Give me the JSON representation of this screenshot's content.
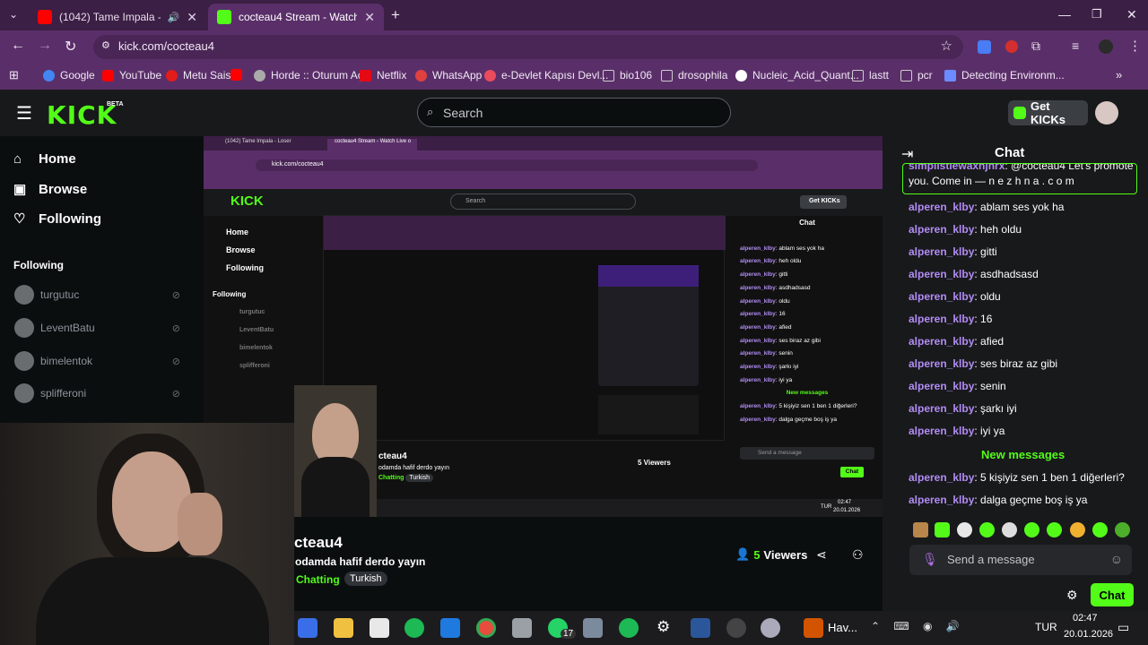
{
  "browser": {
    "tabs": [
      {
        "title": "(1042) Tame Impala - Loser",
        "favicon_color": "#ff0000"
      },
      {
        "title": "cocteau4 Stream - Watch Live o",
        "favicon_color": "#53fc18"
      }
    ],
    "new_tab_symbol": "+",
    "url": "kick.com/cocteau4",
    "bookmarks": [
      {
        "label": "Google",
        "color": "#4285f4"
      },
      {
        "label": "YouTube",
        "color": "#ff0000"
      },
      {
        "label": "Metu Sais",
        "color": "#e21b1b"
      },
      {
        "label": "",
        "color": "#ff0000"
      },
      {
        "label": "Horde :: Oturum Aç",
        "color": "#aaaaaa"
      },
      {
        "label": "Netflix",
        "color": "#e50914"
      },
      {
        "label": "WhatsApp",
        "color": "#e04040"
      },
      {
        "label": "e-Devlet Kapısı Devl...",
        "color": "#e94b5c"
      },
      {
        "label": "bio106",
        "color": "#cccccc"
      },
      {
        "label": "drosophila",
        "color": "#cccccc"
      },
      {
        "label": "Nucleic_Acid_Quant...",
        "color": "#ffffff"
      },
      {
        "label": "lastt",
        "color": "#cccccc"
      },
      {
        "label": "pcr",
        "color": "#cccccc"
      },
      {
        "label": "Detecting Environm...",
        "color": "#6a8cff"
      }
    ]
  },
  "kick": {
    "logo": "KICK",
    "beta": "BETA",
    "search_placeholder": "Search",
    "get_kicks": "Get KICKs",
    "accent": "#53fc18"
  },
  "sidebar": {
    "nav": [
      {
        "label": "Home",
        "icon": "home-icon"
      },
      {
        "label": "Browse",
        "icon": "browse-icon"
      },
      {
        "label": "Following",
        "icon": "heart-icon"
      }
    ],
    "following_title": "Following",
    "following": [
      "turgutuc",
      "LeventBatu",
      "bimelentok",
      "splifferoni"
    ]
  },
  "stream": {
    "channel": "cteau4",
    "title": "odamda hafif derdo yayın",
    "category": "Chatting",
    "tag": "Turkish",
    "viewers": "5",
    "viewers_label": "Viewers"
  },
  "inner": {
    "url": "kick.com/cocteau4",
    "search": "Search",
    "get_kicks": "Get KICKs",
    "nav": [
      "Home",
      "Browse",
      "Following"
    ],
    "following_title": "Following",
    "following": [
      "turgutuc",
      "LeventBatu",
      "bimelentok",
      "splifferoni"
    ],
    "chat_title": "Chat",
    "channel": "cteau4",
    "title": "odamda hafif derdo yayın",
    "category": "Chatting",
    "tag": "Turkish",
    "viewers": "5 Viewers",
    "send": "Send a message",
    "chat_btn": "Chat",
    "time": "02:47",
    "date": "20.01.2026",
    "lang": "TUR",
    "new_messages": "New messages",
    "messages": [
      {
        "user": "alperen_klby",
        "text": "ablam ses yok ha"
      },
      {
        "user": "alperen_klby",
        "text": "heh oldu"
      },
      {
        "user": "alperen_klby",
        "text": "gitti"
      },
      {
        "user": "alperen_klby",
        "text": "asdhadsasd"
      },
      {
        "user": "alperen_klby",
        "text": "oldu"
      },
      {
        "user": "alperen_klby",
        "text": "16"
      },
      {
        "user": "alperen_klby",
        "text": "afied"
      },
      {
        "user": "alperen_klby",
        "text": "ses biraz az gibi"
      },
      {
        "user": "alperen_klby",
        "text": "senin"
      },
      {
        "user": "alperen_klby",
        "text": "şarkı iyi"
      },
      {
        "user": "alperen_klby",
        "text": "iyi ya"
      }
    ],
    "new_msgs": [
      {
        "user": "alperen_klby",
        "text": "5 kişiyiz sen 1 ben 1 diğerleri?"
      },
      {
        "user": "alperen_klby",
        "text": "dalga geçme boş iş ya"
      }
    ]
  },
  "chat": {
    "title": "Chat",
    "pinned_user": "simplistiewaxhjhrx",
    "pinned_text": ": @cocteau4 Let's promote",
    "pinned_text2": "you. Come in — n e z h n a . c o m",
    "messages": [
      {
        "user": "alperen_klby",
        "text": ": ablam ses yok ha"
      },
      {
        "user": "alperen_klby",
        "text": ": heh oldu"
      },
      {
        "user": "alperen_klby",
        "text": ": gitti"
      },
      {
        "user": "alperen_klby",
        "text": ": asdhadsasd"
      },
      {
        "user": "alperen_klby",
        "text": ": oldu"
      },
      {
        "user": "alperen_klby",
        "text": ": 16"
      },
      {
        "user": "alperen_klby",
        "text": ": afied"
      },
      {
        "user": "alperen_klby",
        "text": ": ses biraz az gibi"
      },
      {
        "user": "alperen_klby",
        "text": ": senin"
      },
      {
        "user": "alperen_klby",
        "text": ": şarkı iyi"
      },
      {
        "user": "alperen_klby",
        "text": ": iyi ya"
      }
    ],
    "new_messages_label": "New messages",
    "new_messages": [
      {
        "user": "alperen_klby",
        "text": ": 5 kişiyiz sen 1 ben 1 diğerleri?"
      },
      {
        "user": "alperen_klby",
        "text": ": dalga geçme boş iş ya"
      }
    ],
    "input_placeholder": "Send a message",
    "send_button": "Chat"
  },
  "taskbar": {
    "weather_label": "Hav...",
    "language": "TUR",
    "time": "02:47",
    "date": "20.01.2026",
    "whatsapp_badge": "17"
  }
}
